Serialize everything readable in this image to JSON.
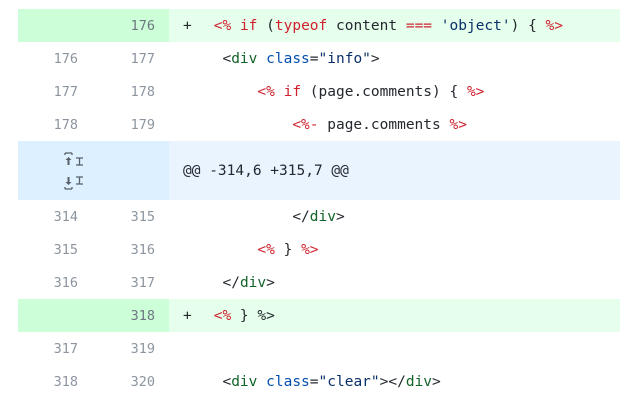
{
  "rows": [
    {
      "type": "add",
      "old": "",
      "new": "176",
      "sign": "+",
      "tokens": [
        [
          "t-p",
          " "
        ],
        [
          "t-d",
          "<%"
        ],
        [
          "t-p",
          " "
        ],
        [
          "t-k",
          "if"
        ],
        [
          "t-p",
          " ("
        ],
        [
          "t-k",
          "typeof"
        ],
        [
          "t-p",
          " content "
        ],
        [
          "t-k",
          "==="
        ],
        [
          "t-p",
          " "
        ],
        [
          "t-s",
          "'object'"
        ],
        [
          "t-p",
          ") { "
        ],
        [
          "t-d",
          "%>"
        ]
      ]
    },
    {
      "type": "ctx",
      "old": "176",
      "new": "177",
      "sign": "",
      "tokens": [
        [
          "t-p",
          "  "
        ],
        [
          "t-p",
          "<"
        ],
        [
          "t-t",
          "div"
        ],
        [
          "t-p",
          " "
        ],
        [
          "t-a",
          "class"
        ],
        [
          "t-p",
          "="
        ],
        [
          "t-s",
          "\"info\""
        ],
        [
          "t-p",
          ">"
        ]
      ]
    },
    {
      "type": "ctx",
      "old": "177",
      "new": "178",
      "sign": "",
      "tokens": [
        [
          "t-p",
          "      "
        ],
        [
          "t-d",
          "<%"
        ],
        [
          "t-p",
          " "
        ],
        [
          "t-k",
          "if"
        ],
        [
          "t-p",
          " (page.comments) { "
        ],
        [
          "t-d",
          "%>"
        ]
      ]
    },
    {
      "type": "ctx",
      "old": "178",
      "new": "179",
      "sign": "",
      "tokens": [
        [
          "t-p",
          "          "
        ],
        [
          "t-d",
          "<%-"
        ],
        [
          "t-p",
          " page.comments "
        ],
        [
          "t-d",
          "%>"
        ]
      ]
    },
    {
      "type": "hunk",
      "old": "",
      "new": "",
      "sign": "",
      "tokens": [
        [
          "t-p",
          "@@ -314,6 +315,7 @@"
        ]
      ]
    },
    {
      "type": "ctx",
      "old": "314",
      "new": "315",
      "sign": "",
      "tokens": [
        [
          "t-p",
          "          "
        ],
        [
          "t-p",
          "</"
        ],
        [
          "t-t",
          "div"
        ],
        [
          "t-p",
          ">"
        ]
      ]
    },
    {
      "type": "ctx",
      "old": "315",
      "new": "316",
      "sign": "",
      "tokens": [
        [
          "t-p",
          "      "
        ],
        [
          "t-d",
          "<%"
        ],
        [
          "t-p",
          " } "
        ],
        [
          "t-d",
          "%>"
        ]
      ]
    },
    {
      "type": "ctx",
      "old": "316",
      "new": "317",
      "sign": "",
      "tokens": [
        [
          "t-p",
          "  "
        ],
        [
          "t-p",
          "</"
        ],
        [
          "t-t",
          "div"
        ],
        [
          "t-p",
          ">"
        ]
      ]
    },
    {
      "type": "add",
      "old": "",
      "new": "318",
      "sign": "+",
      "tokens": [
        [
          "t-p",
          " "
        ],
        [
          "t-d",
          "<%"
        ],
        [
          "t-p",
          " } %>"
        ]
      ]
    },
    {
      "type": "ctx",
      "old": "317",
      "new": "319",
      "sign": "",
      "tokens": [
        [
          "t-p",
          ""
        ]
      ]
    },
    {
      "type": "ctx",
      "old": "318",
      "new": "320",
      "sign": "",
      "tokens": [
        [
          "t-p",
          "  "
        ],
        [
          "t-p",
          "<"
        ],
        [
          "t-t",
          "div"
        ],
        [
          "t-p",
          " "
        ],
        [
          "t-a",
          "class"
        ],
        [
          "t-p",
          "="
        ],
        [
          "t-s",
          "\"clear\""
        ],
        [
          "t-p",
          "></"
        ],
        [
          "t-t",
          "div"
        ],
        [
          "t-p",
          ">"
        ]
      ]
    }
  ],
  "hunk_controls": {
    "expand_up_icon": "expand-up-icon",
    "expand_down_icon": "expand-down-icon"
  },
  "colors": {
    "add_num_bg": "#ccffd8",
    "add_code_bg": "#e6ffec",
    "hunk_num_bg": "#ddf0ff",
    "hunk_code_bg": "#eaf4ff"
  }
}
